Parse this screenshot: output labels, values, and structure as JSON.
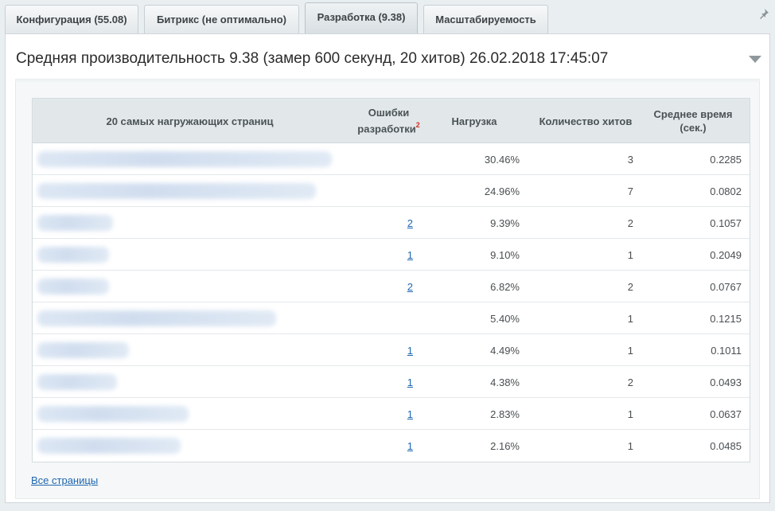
{
  "tabs": [
    {
      "label": "Конфигурация (55.08)",
      "active": false
    },
    {
      "label": "Битрикс (не оптимально)",
      "active": false
    },
    {
      "label": "Разработка (9.38)",
      "active": true
    },
    {
      "label": "Масштабируемость",
      "active": false
    }
  ],
  "pin_icon": "pin-icon",
  "panel": {
    "title": "Средняя производительность 9.38 (замер 600 секунд, 20 хитов) 26.02.2018 17:45:07"
  },
  "table": {
    "headers": {
      "page": "20 самых нагружающих страниц",
      "errors_line1": "Ошибки",
      "errors_line2": "разработки",
      "errors_sup": "2",
      "load": "Нагрузка",
      "hits": "Количество хитов",
      "avg_line1": "Среднее время",
      "avg_line2": "(сек.)"
    },
    "rows": [
      {
        "errors": "",
        "load": "30.46%",
        "hits": "3",
        "avg": "0.2285"
      },
      {
        "errors": "",
        "load": "24.96%",
        "hits": "7",
        "avg": "0.0802"
      },
      {
        "errors": "2",
        "load": "9.39%",
        "hits": "2",
        "avg": "0.1057"
      },
      {
        "errors": "1",
        "load": "9.10%",
        "hits": "1",
        "avg": "0.2049"
      },
      {
        "errors": "2",
        "load": "6.82%",
        "hits": "2",
        "avg": "0.0767"
      },
      {
        "errors": "",
        "load": "5.40%",
        "hits": "1",
        "avg": "0.1215"
      },
      {
        "errors": "1",
        "load": "4.49%",
        "hits": "1",
        "avg": "0.1011"
      },
      {
        "errors": "1",
        "load": "4.38%",
        "hits": "2",
        "avg": "0.0493"
      },
      {
        "errors": "1",
        "load": "2.83%",
        "hits": "1",
        "avg": "0.0637"
      },
      {
        "errors": "1",
        "load": "2.16%",
        "hits": "1",
        "avg": "0.0485"
      }
    ]
  },
  "footer": {
    "all_pages_link": "Все страницы"
  },
  "colors": {
    "link": "#2067b0",
    "superscript": "#d52b1e",
    "header_bg": "#e2e8ea"
  }
}
